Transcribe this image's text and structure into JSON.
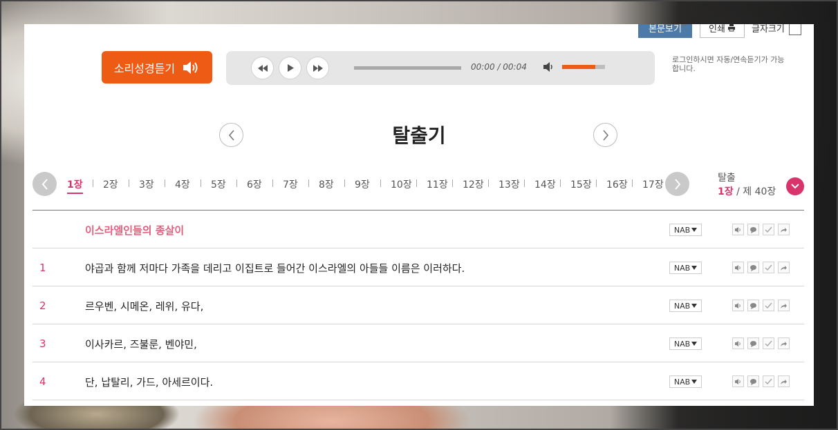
{
  "top_tools": {
    "view_label": "본문보기",
    "print_label": "인쇄",
    "font_label": "글자크기"
  },
  "audio": {
    "listen_label": "소리성경듣기",
    "time": "00:00 / 00:04",
    "volume_fraction": 0.77,
    "login_note": "로그인하시면 자동/연속듣기가 가능합니다."
  },
  "book": {
    "title": "탈출기"
  },
  "chapters": {
    "items": [
      "1장",
      "2장",
      "3장",
      "4장",
      "5장",
      "6장",
      "7장",
      "8장",
      "9장",
      "10장",
      "11장",
      "12장",
      "13장",
      "14장",
      "15장",
      "16장",
      "17장"
    ],
    "active_index": 0,
    "current_book": "탈출",
    "current_chapter": "1장",
    "total": "/ 제 40장"
  },
  "verses": [
    {
      "num": "",
      "text": "이스라엘인들의 종살이",
      "version": "NAB",
      "heading": true
    },
    {
      "num": "1",
      "text": "야곱과 함께 저마다 가족을 데리고 이집트로 들어간 이스라엘의 아들들 이름은 이러하다.",
      "version": "NAB"
    },
    {
      "num": "2",
      "text": "르우벤, 시메온, 레위, 유다,",
      "version": "NAB"
    },
    {
      "num": "3",
      "text": "이사카르, 즈불룬, 벤야민,",
      "version": "NAB"
    },
    {
      "num": "4",
      "text": "단, 납탈리, 가드, 아세르이다.",
      "version": "NAB"
    }
  ],
  "colors": {
    "accent_orange": "#ee5b14",
    "accent_red": "#d8336a",
    "view_blue": "#4d7aa6"
  }
}
